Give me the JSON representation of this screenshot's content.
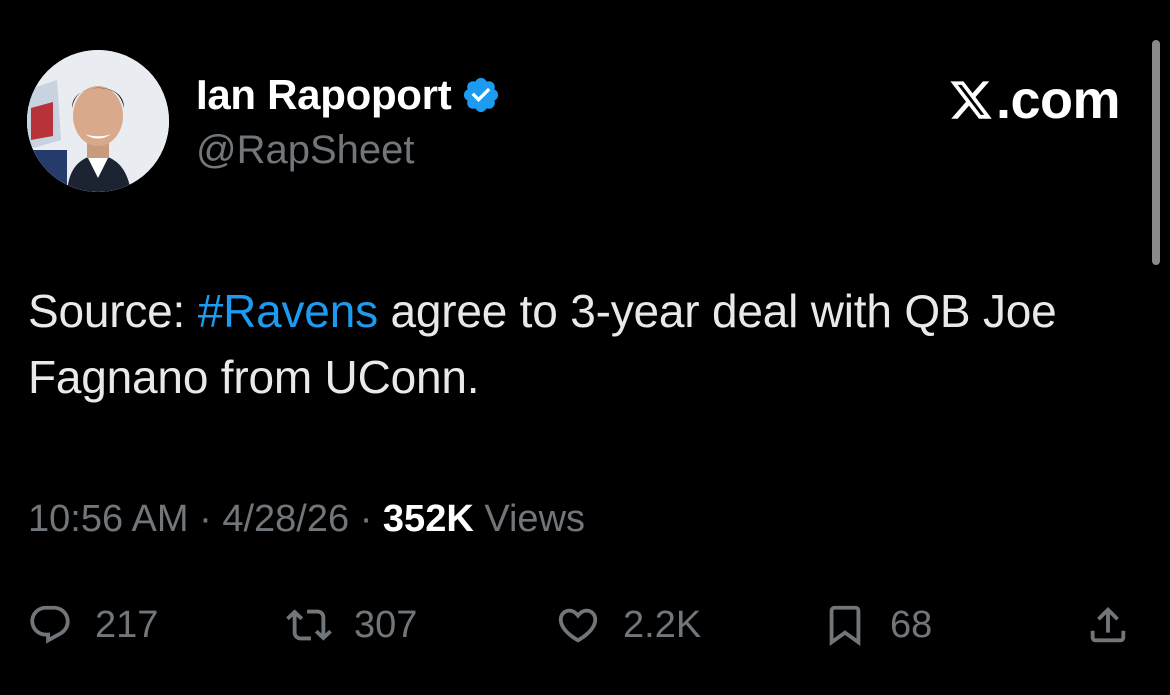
{
  "author": {
    "name": "Ian Rapoport",
    "handle": "@RapSheet",
    "verified": true,
    "avatar_icon": "avatar-photo"
  },
  "brand": {
    "label": ".com",
    "logo_icon": "x-logo-icon"
  },
  "tweet": {
    "text_before": "Source: ",
    "hashtag": "#Ravens",
    "text_after": " agree to 3-year deal with QB Joe Fagnano from UConn."
  },
  "meta": {
    "time": "10:56 AM",
    "separator": "·",
    "date": "4/28/26",
    "views_count": "352K",
    "views_label": "Views"
  },
  "actions": {
    "reply": {
      "icon": "reply-icon",
      "count": "217"
    },
    "retweet": {
      "icon": "retweet-icon",
      "count": "307"
    },
    "like": {
      "icon": "heart-icon",
      "count": "2.2K"
    },
    "bookmark": {
      "icon": "bookmark-icon",
      "count": "68"
    },
    "share": {
      "icon": "share-icon"
    }
  },
  "colors": {
    "background": "#000000",
    "text_primary": "#e7e9ea",
    "text_secondary": "#71767b",
    "link": "#1d9bf0",
    "verified_badge": "#1d9bf0"
  }
}
